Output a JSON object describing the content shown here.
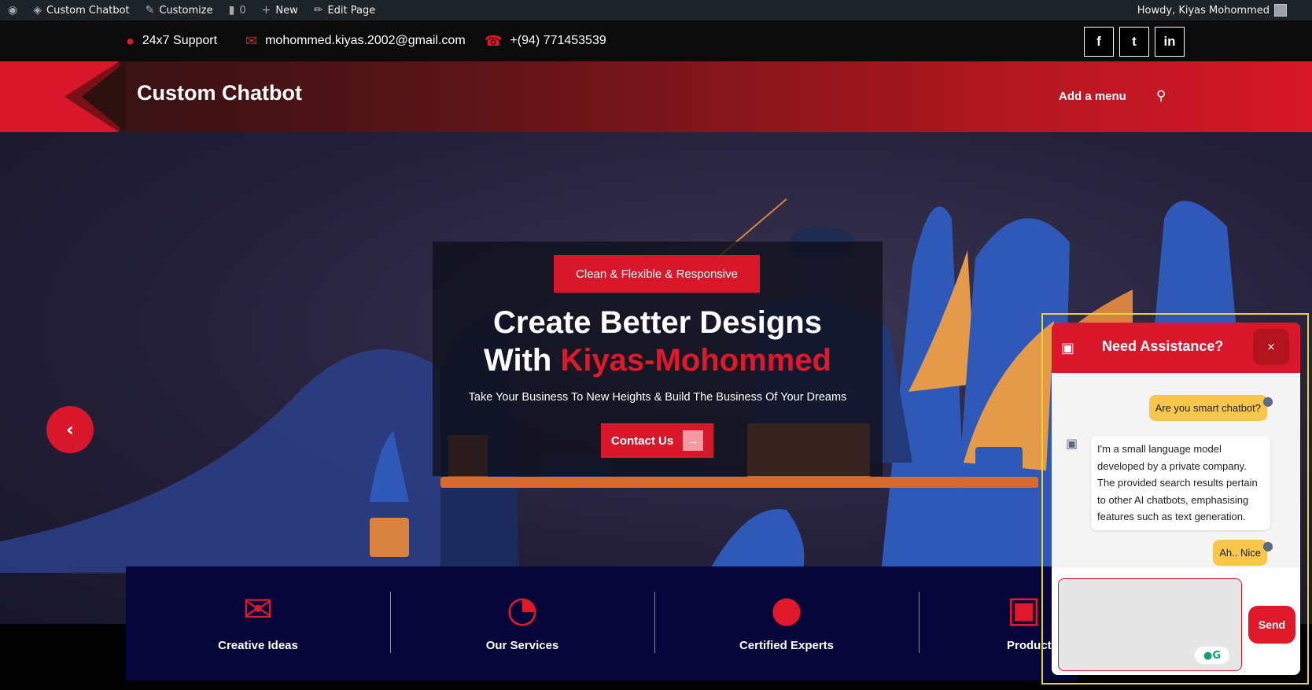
{
  "admin_bar": {
    "site_name": "Custom Chatbot",
    "customize": "Customize",
    "comments_count": "0",
    "new_label": "New",
    "edit_page": "Edit Page",
    "howdy": "Howdy, Kiyas Mohommed"
  },
  "topbar": {
    "support": "24x7 Support",
    "email": "mohommed.kiyas.2002@gmail.com",
    "phone": "+(94) 771453539",
    "social": [
      "f",
      "t",
      "in"
    ]
  },
  "header": {
    "site_title": "Custom Chatbot",
    "menu_link": "Add a menu"
  },
  "hero": {
    "tagline": "Clean & Flexible & Responsive",
    "title_line1": "Create Better Designs",
    "title_prefix": "With ",
    "title_accent": "Kiyas-Mohommed",
    "subtitle": "Take Your Business To New Heights & Build The Business Of Your Dreams",
    "cta": "Contact Us"
  },
  "features": [
    {
      "label": "Creative Ideas",
      "icon": "envelope-icon"
    },
    {
      "label": "Our Services",
      "icon": "pie-chart-icon"
    },
    {
      "label": "Certified Experts",
      "icon": "user-icon"
    },
    {
      "label": "Product",
      "icon": "cube-icon"
    }
  ],
  "chat": {
    "title": "Need Assistance?",
    "close": "×",
    "messages": [
      {
        "from": "user",
        "text": "Are you smart chatbot?"
      },
      {
        "from": "bot",
        "text": "I'm a small language model developed by a private company. The provided search results pertain to other AI chatbots, emphasising features such as text generation."
      },
      {
        "from": "user",
        "text": "Ah.. Nice"
      }
    ],
    "input_value": "",
    "send": "Send"
  },
  "colors": {
    "accent": "#d8172a",
    "chat_bubble_user": "#f8c64b",
    "features_bg": "#05053a",
    "highlight_outline": "#e6d43a"
  }
}
